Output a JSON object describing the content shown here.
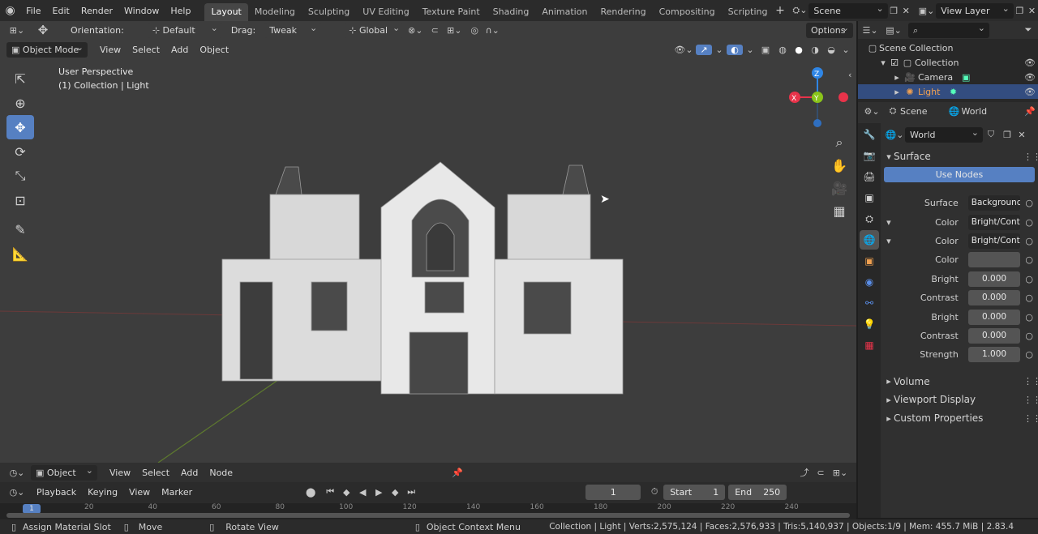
{
  "menu": [
    "File",
    "Edit",
    "Render",
    "Window",
    "Help"
  ],
  "workspaces": [
    "Layout",
    "Modeling",
    "Sculpting",
    "UV Editing",
    "Texture Paint",
    "Shading",
    "Animation",
    "Rendering",
    "Compositing",
    "Scripting"
  ],
  "active_workspace": "Layout",
  "scene_name": "Scene",
  "view_layer": "View Layer",
  "tool_header": {
    "orientation_label": "Orientation:",
    "orientation_value": "Default",
    "drag_label": "Drag:",
    "drag_value": "Tweak",
    "transform_value": "Global",
    "options_label": "Options"
  },
  "viewport_header": {
    "mode": "Object Mode",
    "menus": [
      "View",
      "Select",
      "Add",
      "Object"
    ]
  },
  "viewport_overlay": {
    "line1": "User Perspective",
    "line2": "(1) Collection | Light"
  },
  "gizmo": {
    "x": "X",
    "y": "Y",
    "z": "Z"
  },
  "outliner": {
    "search_placeholder": "",
    "items": [
      {
        "label": "Scene Collection"
      },
      {
        "label": "Collection"
      },
      {
        "label": "Camera"
      },
      {
        "label": "Light"
      }
    ]
  },
  "properties": {
    "tabs_scene": "Scene",
    "tabs_world": "World",
    "world_name": "World",
    "surface_panel": "Surface",
    "use_nodes": "Use Nodes",
    "rows": [
      {
        "label": "Surface",
        "value": "Background"
      },
      {
        "label": "Color",
        "value": "Bright/Cont..."
      },
      {
        "label": "Color",
        "value": "Bright/Cont..."
      },
      {
        "label": "Color",
        "value": ""
      },
      {
        "label": "Bright",
        "value": "0.000"
      },
      {
        "label": "Contrast",
        "value": "0.000"
      },
      {
        "label": "Bright",
        "value": "0.000"
      },
      {
        "label": "Contrast",
        "value": "0.000"
      },
      {
        "label": "Strength",
        "value": "1.000"
      }
    ],
    "collapsed_panels": [
      "Volume",
      "Viewport Display",
      "Custom Properties"
    ]
  },
  "node_header": {
    "object_value": "Object",
    "menus": [
      "View",
      "Select",
      "Add",
      "Node"
    ]
  },
  "timeline": {
    "menus": [
      "Playback",
      "Keying",
      "View",
      "Marker"
    ],
    "current_frame": "1",
    "start_label": "Start",
    "start_value": "1",
    "end_label": "End",
    "end_value": "250",
    "ruler_marks": [
      "20",
      "40",
      "60",
      "80",
      "100",
      "120",
      "140",
      "160",
      "180",
      "200",
      "220",
      "240"
    ],
    "frame_indicator": "1"
  },
  "statusbar": {
    "left1": "Assign Material Slot",
    "left2": "Move",
    "left3": "Rotate View",
    "middle": "Object Context Menu",
    "right": "Collection | Light | Verts:2,575,124 | Faces:2,576,933 | Tris:5,140,937 | Objects:1/9 | Mem: 455.7 MiB | 2.83.4"
  },
  "colors": {
    "accent": "#5680c2",
    "viewport_bg": "#3d3d3d",
    "light_selected": "#f0a050",
    "axis_x": "#e8334a",
    "axis_y": "#8ac41a",
    "axis_z": "#2f86e6"
  }
}
